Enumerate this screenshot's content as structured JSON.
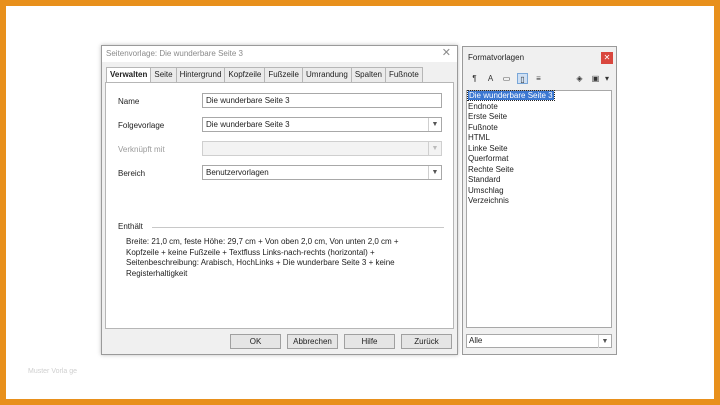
{
  "dialog": {
    "title": "Seitenvorlage: Die wunderbare Seite 3",
    "close_glyph": "✕",
    "tabs": [
      "Verwalten",
      "Seite",
      "Hintergrund",
      "Kopfzeile",
      "Fußzeile",
      "Umrandung",
      "Spalten",
      "Fußnote"
    ],
    "active_tab": "Verwalten",
    "fields": {
      "name": {
        "label": "Name",
        "value": "Die wunderbare Seite 3"
      },
      "folgevorlage": {
        "label": "Folgevorlage",
        "value": "Die wunderbare Seite 3"
      },
      "verknuepft": {
        "label": "Verknüpft mit",
        "value": ""
      },
      "bereich": {
        "label": "Bereich",
        "value": "Benutzervorlagen"
      }
    },
    "section_title": "Enthält",
    "description": "Breite: 21,0 cm, feste Höhe: 29,7 cm + Von oben 2,0 cm, Von unten 2,0 cm + Kopfzeile + keine Fußzeile + Textfluss Links-nach-rechts (horizontal) + Seitenbeschreibung: Arabisch, HochLinks + Die wunderbare Seite 3 + keine Registerhaltigkeit",
    "buttons": {
      "ok": "OK",
      "cancel": "Abbrechen",
      "help": "Hilfe",
      "back": "Zurück"
    }
  },
  "styles_panel": {
    "title": "Formatvorlagen",
    "close_glyph": "✕",
    "toolbar_icons": [
      "paragraph-styles-icon",
      "character-styles-icon",
      "frame-styles-icon",
      "page-styles-icon",
      "list-styles-icon",
      "fill-format-icon",
      "new-style-icon"
    ],
    "items": [
      "Die wunderbare Seite 3",
      "Endnote",
      "Erste Seite",
      "Fußnote",
      "HTML",
      "Linke Seite",
      "Querformat",
      "Rechte Seite",
      "Standard",
      "Umschlag",
      "Verzeichnis"
    ],
    "selected_index": 0,
    "filter": "Alle"
  },
  "watermark": "Muster Vorla ge"
}
